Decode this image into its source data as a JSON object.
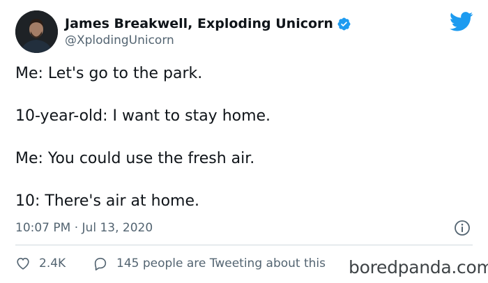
{
  "header": {
    "display_name": "James Breakwell, Exploding Unicorn",
    "handle": "@XplodingUnicorn"
  },
  "tweet": {
    "lines": [
      "Me: Let's go to the park.",
      "10-year-old: I want to stay home.",
      "Me: You could use the fresh air.",
      "10: There's air at home."
    ],
    "timestamp": "10:07 PM · Jul 13, 2020"
  },
  "actions": {
    "likes": "2.4K",
    "replies_text": "145 people are Tweeting about this"
  },
  "watermark": "boredpanda.com",
  "icons": {
    "verified": "verified-badge-icon",
    "brand": "twitter-bird-icon",
    "info": "info-icon",
    "like": "heart-icon",
    "reply": "speech-bubble-icon"
  },
  "colors": {
    "twitter_blue": "#1d9bf0",
    "text_primary": "#0f1419",
    "text_secondary": "#536471",
    "divider": "#cfd9de"
  }
}
